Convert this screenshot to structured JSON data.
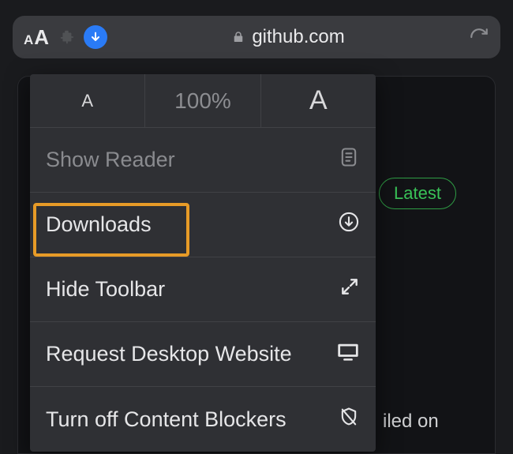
{
  "urlbar": {
    "domain": "github.com",
    "zoom": "100%"
  },
  "menu": {
    "zoom_out": "A",
    "zoom_in": "A",
    "items": {
      "reader": "Show Reader",
      "downloads": "Downloads",
      "hide_toolbar": "Hide Toolbar",
      "desktop": "Request Desktop Website",
      "blockers": "Turn off Content Blockers"
    }
  },
  "page": {
    "latest_badge": "Latest",
    "snippet": "iled on"
  }
}
